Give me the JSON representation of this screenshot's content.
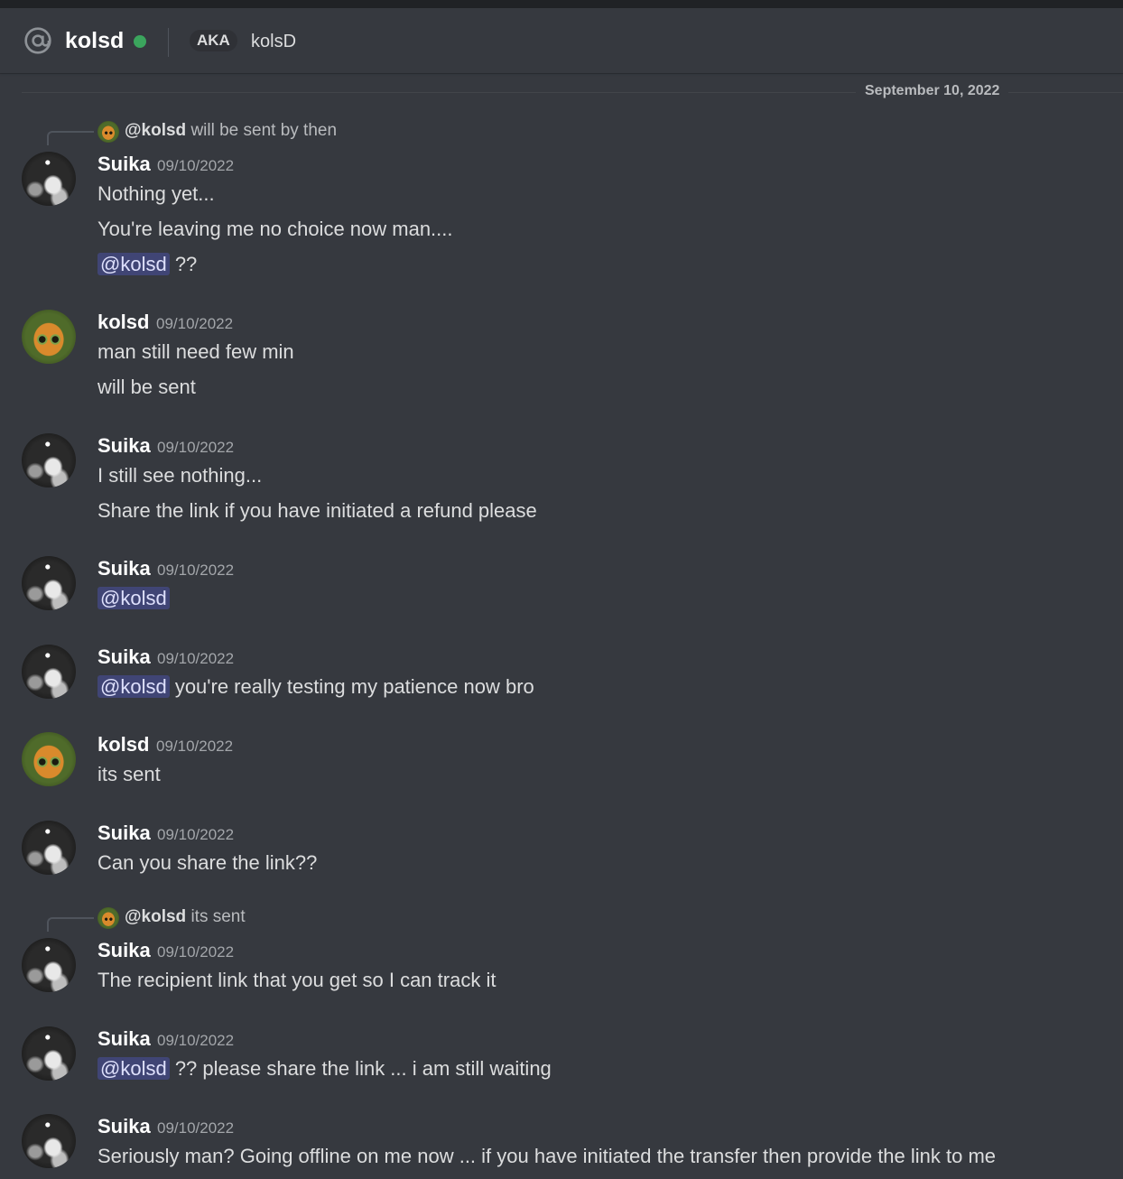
{
  "header": {
    "channel_icon": "at-icon",
    "title": "kolsd",
    "status": "online",
    "aka_badge": "AKA",
    "aka_name": "kolsD"
  },
  "date_divider": "September 10, 2022",
  "colors": {
    "background": "#36393f",
    "online": "#3ba55d",
    "mention_bg": "rgba(88,101,242,0.3)",
    "mention_text": "#dee0fc"
  },
  "messages": [
    {
      "reply": {
        "mention": "@kolsd",
        "text": "will be sent by then"
      },
      "author": "Suika",
      "time": "09/10/2022",
      "lines": [
        {
          "text": "Nothing yet..."
        },
        {
          "text": "You're leaving me no choice now man...."
        },
        {
          "mention": "@kolsd",
          "text": " ??"
        }
      ]
    },
    {
      "author": "kolsd",
      "time": "09/10/2022",
      "lines": [
        {
          "text": "man still need few min"
        },
        {
          "text": "will be sent"
        }
      ]
    },
    {
      "author": "Suika",
      "time": "09/10/2022",
      "lines": [
        {
          "text": "I still see nothing..."
        },
        {
          "text": "Share the link if you have initiated a refund please"
        }
      ]
    },
    {
      "author": "Suika",
      "time": "09/10/2022",
      "lines": [
        {
          "mention": "@kolsd",
          "text": ""
        }
      ]
    },
    {
      "author": "Suika",
      "time": "09/10/2022",
      "lines": [
        {
          "mention": "@kolsd",
          "text": " you're really testing my patience now bro"
        }
      ]
    },
    {
      "author": "kolsd",
      "time": "09/10/2022",
      "lines": [
        {
          "text": "its sent"
        }
      ]
    },
    {
      "author": "Suika",
      "time": "09/10/2022",
      "lines": [
        {
          "text": "Can you share the link??"
        }
      ]
    },
    {
      "reply": {
        "mention": "@kolsd",
        "text": "its sent"
      },
      "author": "Suika",
      "time": "09/10/2022",
      "lines": [
        {
          "text": "The recipient link that you get so I can track it"
        }
      ]
    },
    {
      "author": "Suika",
      "time": "09/10/2022",
      "lines": [
        {
          "mention": "@kolsd",
          "text": " ?? please share the link ... i am still waiting"
        }
      ]
    },
    {
      "author": "Suika",
      "time": "09/10/2022",
      "lines": [
        {
          "text": "Seriously man? Going offline on me now ... if you have initiated the transfer then provide the link to me"
        }
      ]
    }
  ]
}
